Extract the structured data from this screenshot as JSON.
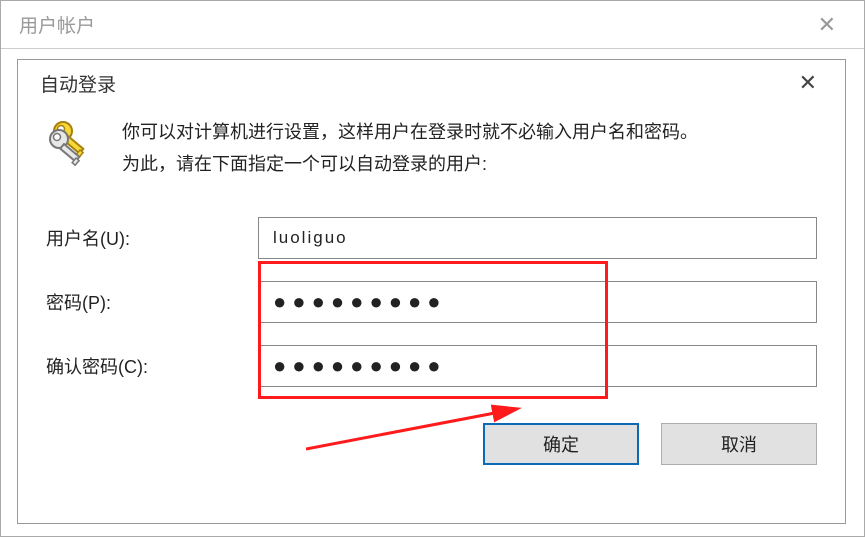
{
  "parent": {
    "title": "用户帐户"
  },
  "modal": {
    "title": "自动登录",
    "info_line1": "你可以对计算机进行设置，这样用户在登录时就不必输入用户名和密码。",
    "info_line2": "为此，请在下面指定一个可以自动登录的用户:"
  },
  "form": {
    "username_label": "用户名(U):",
    "username_value": "luoliguo",
    "password_label": "密码(P):",
    "password_value": "●●●●●●●●●",
    "confirm_label": "确认密码(C):",
    "confirm_value": "●●●●●●●●●"
  },
  "buttons": {
    "ok": "确定",
    "cancel": "取消"
  },
  "annotations": {
    "highlight_color": "#ff1b1b",
    "arrow_color": "#ff1b1b"
  }
}
